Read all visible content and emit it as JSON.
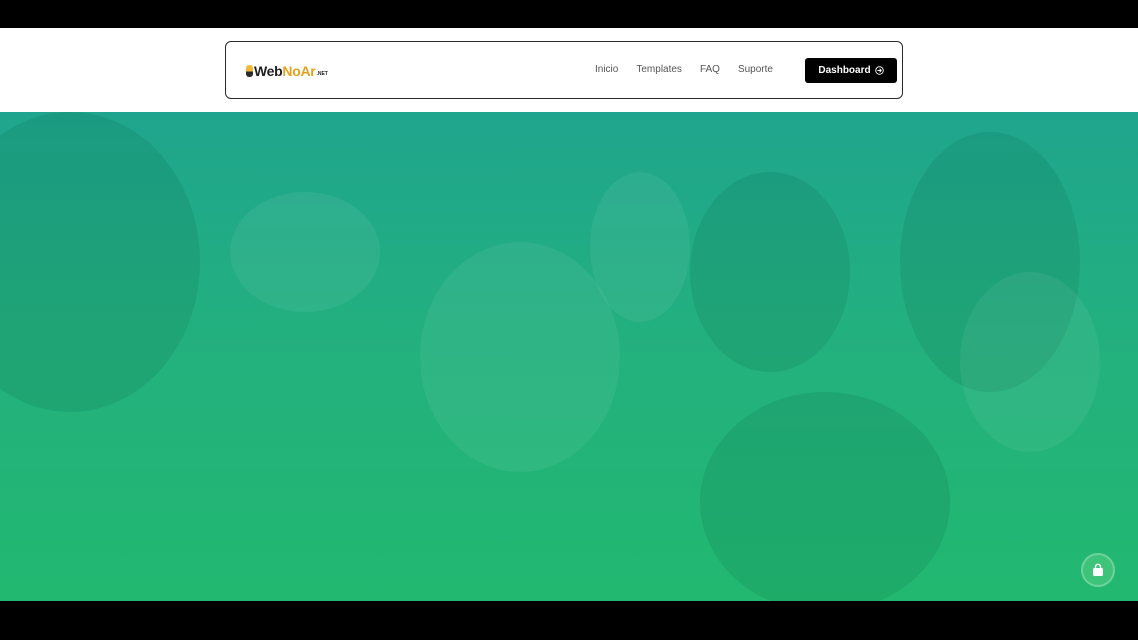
{
  "logo": {
    "part1": "Web",
    "part2": "NoAr",
    "part3": ".NET"
  },
  "nav": {
    "items": [
      {
        "label": "Inicio"
      },
      {
        "label": "Templates"
      },
      {
        "label": "FAQ"
      },
      {
        "label": "Suporte"
      }
    ],
    "dashboard_label": "Dashboard"
  },
  "icons": {
    "dashboard": "arrow-right-circle-icon",
    "cart": "shopping-bag-icon"
  },
  "colors": {
    "brand_yellow": "#e3a21f",
    "hero_green": "#22b870",
    "button_black": "#000000"
  }
}
